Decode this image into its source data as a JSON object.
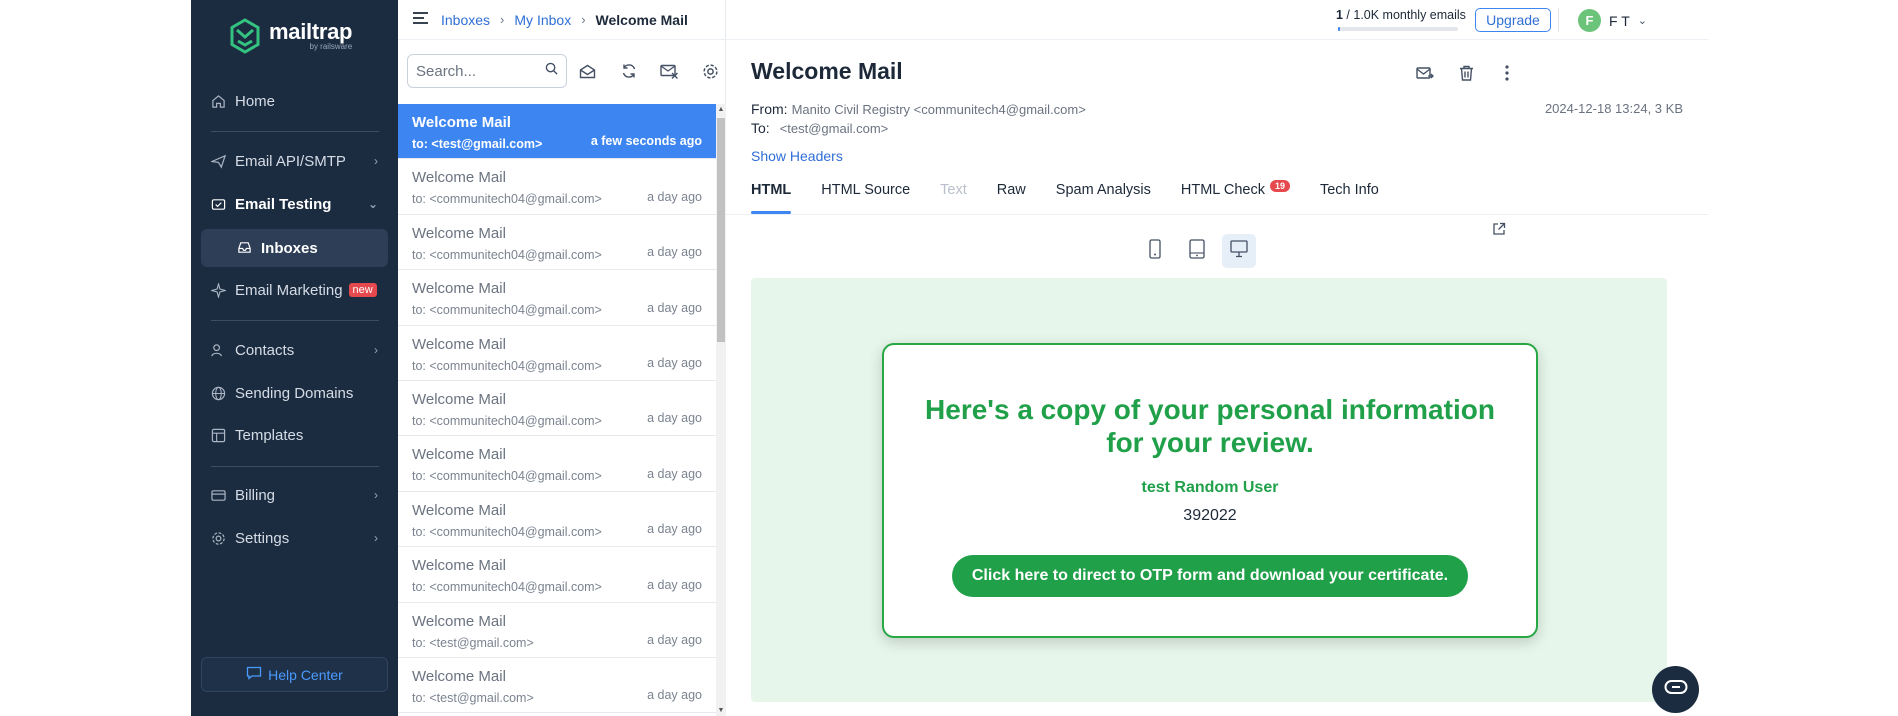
{
  "brand": {
    "name": "mailtrap",
    "sub": "by railsware"
  },
  "sidebar": {
    "home": "Home",
    "email_api": "Email API/SMTP",
    "email_testing": "Email Testing",
    "inboxes": "Inboxes",
    "email_marketing": "Email Marketing",
    "new_badge": "new",
    "contacts": "Contacts",
    "sending_domains": "Sending Domains",
    "templates": "Templates",
    "billing": "Billing",
    "settings": "Settings",
    "help_center": "Help Center"
  },
  "breadcrumb": {
    "inboxes": "Inboxes",
    "my_inbox": "My Inbox",
    "current": "Welcome Mail",
    "sep": "›"
  },
  "search": {
    "placeholder": "Search..."
  },
  "messages": [
    {
      "subject": "Welcome Mail",
      "to": "to: <test@gmail.com>",
      "when": "a few seconds ago"
    },
    {
      "subject": "Welcome Mail",
      "to": "to: <communitech04@gmail.com>",
      "when": "a day ago"
    },
    {
      "subject": "Welcome Mail",
      "to": "to: <communitech04@gmail.com>",
      "when": "a day ago"
    },
    {
      "subject": "Welcome Mail",
      "to": "to: <communitech04@gmail.com>",
      "when": "a day ago"
    },
    {
      "subject": "Welcome Mail",
      "to": "to: <communitech04@gmail.com>",
      "when": "a day ago"
    },
    {
      "subject": "Welcome Mail",
      "to": "to: <communitech04@gmail.com>",
      "when": "a day ago"
    },
    {
      "subject": "Welcome Mail",
      "to": "to: <communitech04@gmail.com>",
      "when": "a day ago"
    },
    {
      "subject": "Welcome Mail",
      "to": "to: <communitech04@gmail.com>",
      "when": "a day ago"
    },
    {
      "subject": "Welcome Mail",
      "to": "to: <communitech04@gmail.com>",
      "when": "a day ago"
    },
    {
      "subject": "Welcome Mail",
      "to": "to: <test@gmail.com>",
      "when": "a day ago"
    },
    {
      "subject": "Welcome Mail",
      "to": "to: <test@gmail.com>",
      "when": "a day ago"
    }
  ],
  "header": {
    "quota_used": "1",
    "quota_text": " / 1.0K monthly emails",
    "quota_fraction": 0.001,
    "upgrade": "Upgrade",
    "user_initial": "F",
    "user_name": "F T"
  },
  "email": {
    "title": "Welcome Mail",
    "from_label": "From:",
    "from_value": "Manito Civil Registry <communitech4@gmail.com>",
    "to_label": "To:",
    "to_value": "<test@gmail.com>",
    "date": "2024-12-18 13:24, 3 KB",
    "show_headers": "Show Headers"
  },
  "tabs": {
    "html": "HTML",
    "html_source": "HTML Source",
    "text": "Text",
    "raw": "Raw",
    "spam": "Spam Analysis",
    "html_check": "HTML Check",
    "html_check_count": "19",
    "tech_info": "Tech Info"
  },
  "body": {
    "heading": "Here's a copy of your personal information for your review.",
    "name": "test Random User",
    "code": "392022",
    "cta": "Click here to direct to OTP form and download your certificate."
  },
  "colors": {
    "accent": "#3d86f1",
    "sidebar": "#1b2b40",
    "green": "#21a04a",
    "preview_bg": "#e6f6ea"
  }
}
